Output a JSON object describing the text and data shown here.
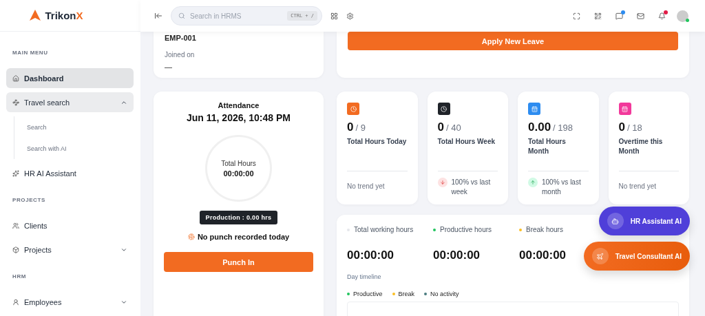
{
  "brand": {
    "name": "Trikon",
    "accent": "X"
  },
  "header": {
    "search": {
      "placeholder": "Search in HRMS",
      "shortcut": "CTRL + /"
    },
    "icons": [
      {
        "kind": "fullscreen",
        "badge": false
      },
      {
        "kind": "apps",
        "badge": false
      },
      {
        "kind": "chat",
        "badge": true
      },
      {
        "kind": "mail",
        "badge": false
      },
      {
        "kind": "bell",
        "badge": true
      }
    ],
    "avatar": {
      "online": true
    }
  },
  "sidebar": {
    "sections": [
      {
        "title": "MAIN MENU",
        "items": [
          {
            "label": "Dashboard",
            "selected": true
          },
          {
            "label": "Travel search",
            "selected": false,
            "expanded": true,
            "children": [
              {
                "label": "Search",
                "selected": false
              },
              {
                "label": "Search with AI",
                "selected": false
              }
            ]
          },
          {
            "label": "HR AI Assistant",
            "selected": false
          }
        ]
      },
      {
        "title": "PROJECTS",
        "items": [
          {
            "label": "Clients",
            "selected": false
          },
          {
            "label": "Projects",
            "selected": false,
            "expanded": false
          }
        ]
      },
      {
        "title": "HRM",
        "items": [
          {
            "label": "Employees",
            "selected": false,
            "expanded": false
          }
        ]
      }
    ]
  },
  "profile": {
    "employee_id": "EMP-001",
    "joined_label": "Joined on",
    "joined_value": "—"
  },
  "leave": {
    "button": "Apply New Leave"
  },
  "attendance": {
    "title": "Attendance",
    "datetime": "Jun 11, 2026, 10:48 PM",
    "ring_label": "Total Hours",
    "ring_value": "00:00:00",
    "production": "Production : 0.00 hrs",
    "status": "No punch recorded today",
    "button": "Punch In"
  },
  "stats": [
    {
      "value": "0",
      "total": "/ 9",
      "label": "Total Hours Today",
      "color": "#f26b21",
      "trend": {
        "kind": "none",
        "text": "No trend yet"
      }
    },
    {
      "value": "0",
      "total": "/ 40",
      "label": "Total Hours Week",
      "color": "#1f2329",
      "trend": {
        "kind": "down",
        "text": "100% vs last week"
      }
    },
    {
      "value": "0.00",
      "total": "/ 198",
      "label": "Total Hours Month",
      "color": "#2d8cf0",
      "trend": {
        "kind": "up",
        "text": "100% vs last month"
      }
    },
    {
      "value": "0",
      "total": "/ 18",
      "label": "Overtime this Month",
      "color": "#f2399b",
      "trend": {
        "kind": "none",
        "text": "No trend yet"
      }
    }
  ],
  "hours": {
    "metrics": [
      {
        "label": "Total working hours",
        "value": "00:00:00",
        "color": "#e5e7eb"
      },
      {
        "label": "Productive hours",
        "value": "00:00:00",
        "color": "#22c55e"
      },
      {
        "label": "Break hours",
        "value": "00:00:00",
        "color": "#fbbf24"
      }
    ],
    "timeline_title": "Day timeline",
    "timeline_legend": [
      {
        "label": "Productive",
        "color": "#22c55e"
      },
      {
        "label": "Break",
        "color": "#fbbf24"
      },
      {
        "label": "No activity",
        "color": "#4b7c80"
      }
    ]
  },
  "assistants": [
    {
      "label": "HR Assistant AI",
      "kind": "bot"
    },
    {
      "label": "Travel Consultant AI",
      "kind": "plane"
    }
  ]
}
